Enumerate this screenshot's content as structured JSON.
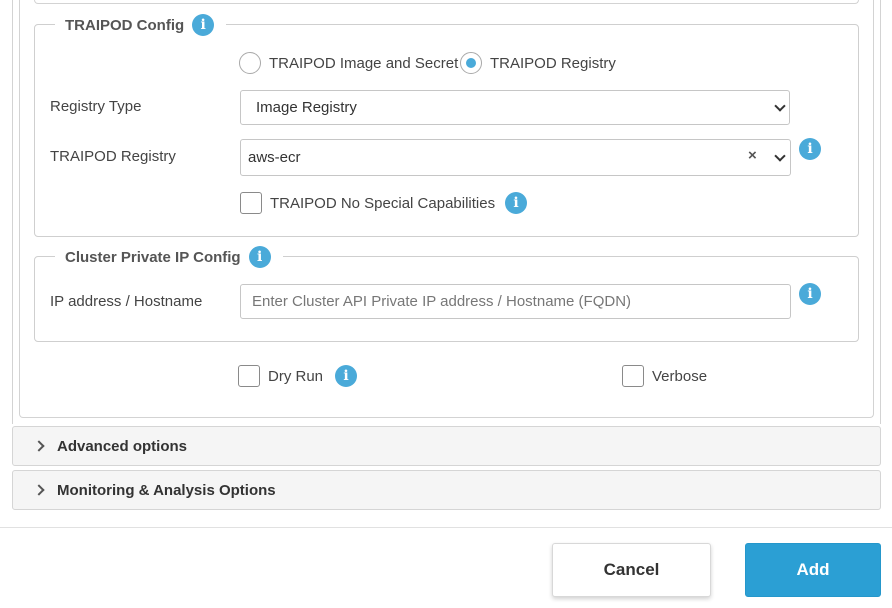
{
  "traipod_config": {
    "title": "TRAIPOD Config",
    "source_options": [
      {
        "label": "TRAIPOD Image and Secret",
        "selected": false
      },
      {
        "label": "TRAIPOD Registry",
        "selected": true
      }
    ],
    "registry_type": {
      "label": "Registry Type",
      "value": "Image Registry"
    },
    "registry": {
      "label": "TRAIPOD Registry",
      "value": "aws-ecr",
      "clear": "×"
    },
    "no_special_capabilities": {
      "label": "TRAIPOD No Special Capabilities",
      "checked": false
    }
  },
  "cluster_private_ip_config": {
    "title": "Cluster Private IP Config",
    "ip_field": {
      "label": "IP address / Hostname",
      "value": "",
      "placeholder": "Enter Cluster API Private IP address / Hostname (FQDN)"
    }
  },
  "options": {
    "dry_run": {
      "label": "Dry Run",
      "checked": false
    },
    "verbose": {
      "label": "Verbose",
      "checked": false
    }
  },
  "accordions": {
    "advanced": "Advanced options",
    "monitoring": "Monitoring & Analysis Options"
  },
  "footer": {
    "cancel_label": "Cancel",
    "add_label": "Add"
  },
  "icons": {
    "info": "info-icon",
    "chevron": "chevron-down-icon",
    "accordion_chevron": "chevron-right-icon"
  },
  "colors": {
    "accent": "#4aaad9",
    "primary_button": "#2b9fd4"
  }
}
